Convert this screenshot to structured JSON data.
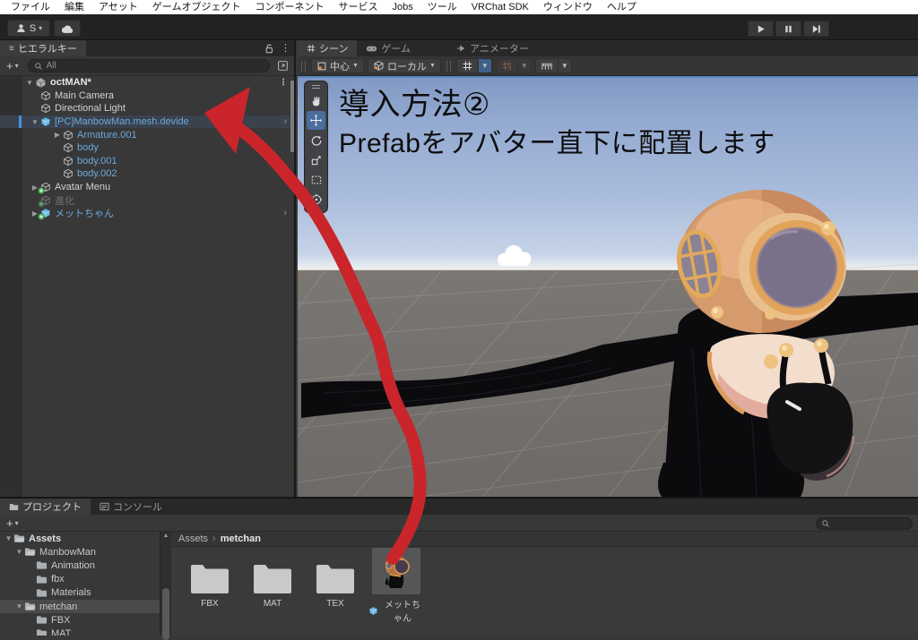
{
  "menu": {
    "items": [
      "ファイル",
      "編集",
      "アセット",
      "ゲームオブジェクト",
      "コンポーネント",
      "サービス",
      "Jobs",
      "ツール",
      "VRChat SDK",
      "ウィンドウ",
      "ヘルプ"
    ]
  },
  "toolbar": {
    "account_label": "S"
  },
  "hierarchy": {
    "tab": "ヒエラルキー",
    "search_placeholder": "All",
    "root": "octMAN*",
    "items": [
      {
        "label": "Main Camera"
      },
      {
        "label": "Directional Light"
      },
      {
        "label": "[PC]ManbowMan.mesh.devide"
      },
      {
        "label": "Armature.001"
      },
      {
        "label": "body"
      },
      {
        "label": "body.001"
      },
      {
        "label": "body.002"
      },
      {
        "label": "Avatar Menu"
      },
      {
        "label": "進化"
      },
      {
        "label": "メットちゃん"
      }
    ]
  },
  "scene": {
    "tabs": {
      "scene": "シーン",
      "game": "ゲーム",
      "animator": "アニメーター"
    },
    "pivot_label": "中心",
    "space_label": "ローカル",
    "overlay": {
      "line1": "導入方法②",
      "line2": "Prefabをアバター直下に配置します"
    }
  },
  "project": {
    "tab": "プロジェクト",
    "console_tab": "コンソール",
    "breadcrumb": {
      "root": "Assets",
      "current": "metchan"
    },
    "tree": [
      "Assets",
      "ManbowMan",
      "Animation",
      "fbx",
      "Materials",
      "metchan",
      "FBX",
      "MAT"
    ],
    "items": [
      {
        "label": "FBX"
      },
      {
        "label": "MAT"
      },
      {
        "label": "TEX"
      },
      {
        "label": "メットちゃん"
      }
    ]
  },
  "colors": {
    "prefab_blue": "#6ca9dc",
    "arrow_red": "#c9252b",
    "selection": "#4a4a4a"
  }
}
